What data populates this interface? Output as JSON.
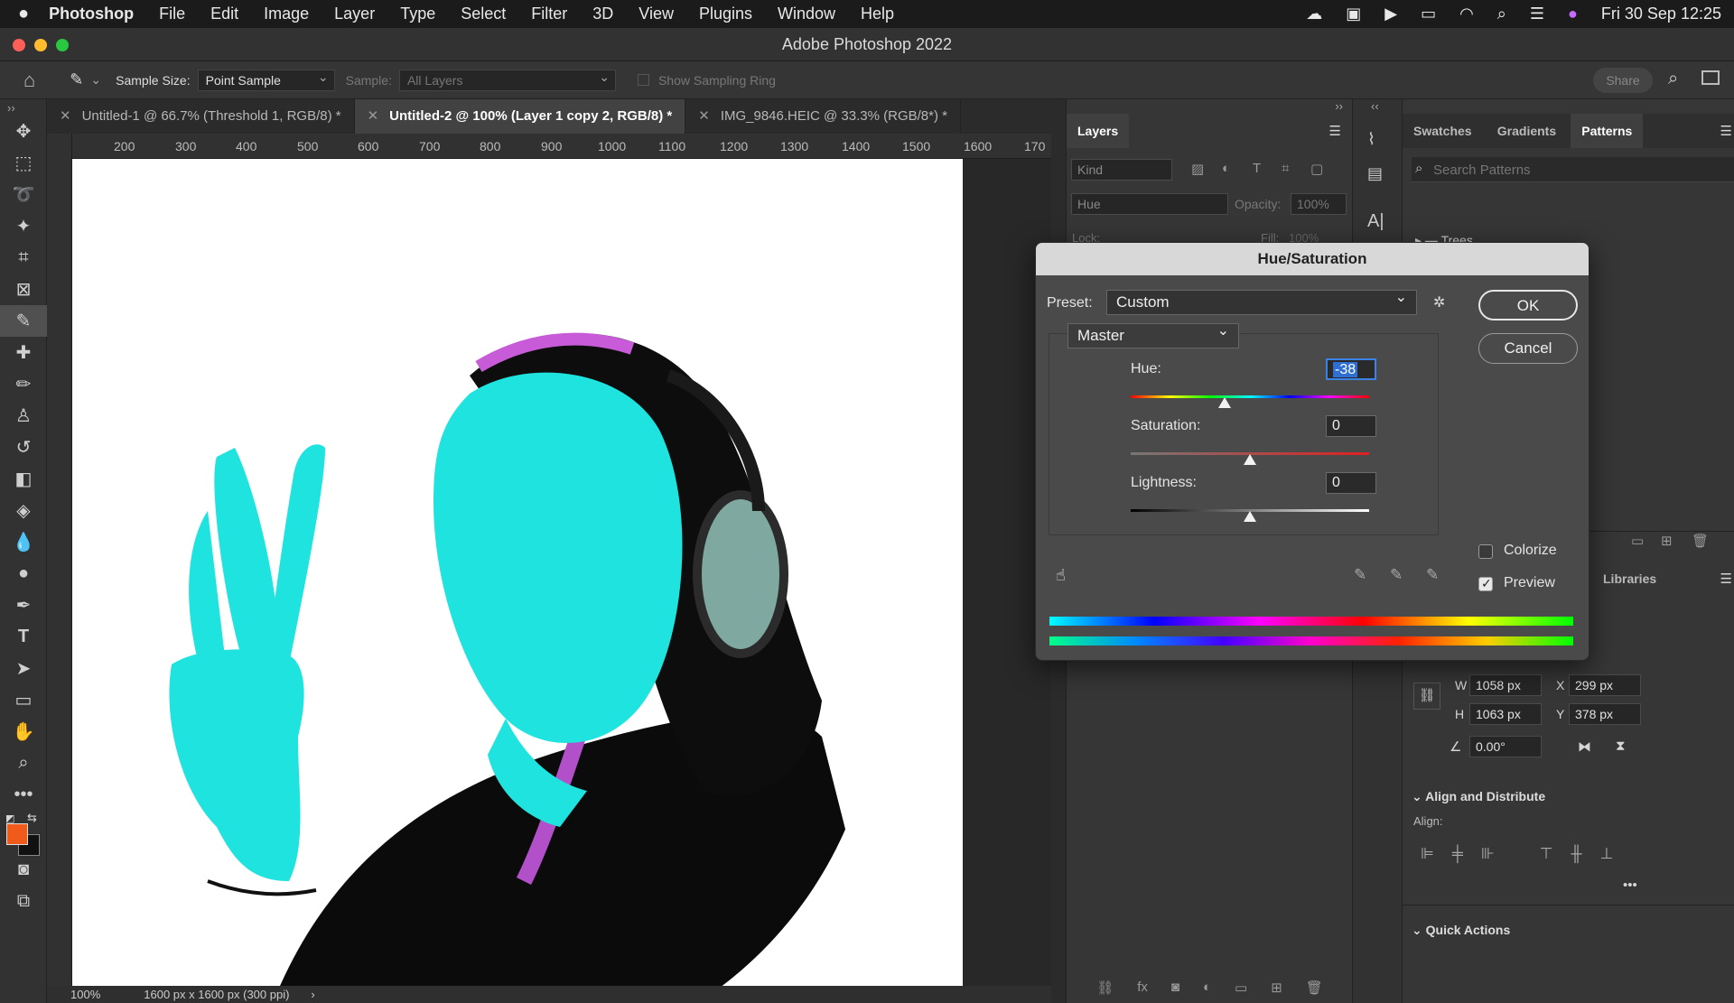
{
  "menubar": {
    "app": "Photoshop",
    "items": [
      "File",
      "Edit",
      "Image",
      "Layer",
      "Type",
      "Select",
      "Filter",
      "3D",
      "View",
      "Plugins",
      "Window",
      "Help"
    ],
    "clock": "Fri 30 Sep  12:25"
  },
  "window": {
    "title": "Adobe Photoshop 2022"
  },
  "options": {
    "sample_size_label": "Sample Size:",
    "sample_size_value": "Point Sample",
    "sample_label": "Sample:",
    "sample_value": "All Layers",
    "show_ring": "Show Sampling Ring",
    "share": "Share"
  },
  "tabs": [
    {
      "label": "Untitled-1 @ 66.7% (Threshold 1, RGB/8) *"
    },
    {
      "label": "Untitled-2 @ 100% (Layer 1 copy 2, RGB/8) *"
    },
    {
      "label": "IMG_9846.HEIC @ 33.3% (RGB/8*) *"
    }
  ],
  "ruler": {
    "h_ticks": [
      "200",
      "300",
      "400",
      "500",
      "600",
      "700",
      "800",
      "900",
      "1000",
      "1100",
      "1200",
      "1300",
      "1400",
      "1500",
      "1600",
      "170"
    ]
  },
  "status": {
    "zoom": "100%",
    "size": "1600 px x 1600 px (300 ppi)"
  },
  "layers": {
    "title": "Layers",
    "kind": "Kind",
    "blend": "Hue",
    "opacity_label": "Opacity:",
    "opacity_value": "100%",
    "lock_label": "Lock:",
    "fill_label": "Fill:",
    "fill_value": "100%"
  },
  "right": {
    "tabs": [
      "Swatches",
      "Gradients",
      "Patterns"
    ],
    "search_placeholder": "Search Patterns",
    "group": "Trees",
    "libraries": "Libraries",
    "w_label": "W",
    "w_value": "1058 px",
    "h_label": "H",
    "h_value": "1063 px",
    "x_label": "X",
    "x_value": "299 px",
    "y_label": "Y",
    "y_value": "378 px",
    "angle": "0.00°",
    "align_title": "Align and Distribute",
    "align_label": "Align:",
    "quick_actions": "Quick Actions"
  },
  "dialog": {
    "title": "Hue/Saturation",
    "preset_label": "Preset:",
    "preset_value": "Custom",
    "channel": "Master",
    "hue_label": "Hue:",
    "hue_value": "-38",
    "hue_level": -38,
    "sat_label": "Saturation:",
    "sat_value": "0",
    "sat_level": 0,
    "light_label": "Lightness:",
    "light_value": "0",
    "light_level": 0,
    "ok": "OK",
    "cancel": "Cancel",
    "colorize": "Colorize",
    "preview": "Preview",
    "preview_checked": true,
    "colorize_checked": false
  }
}
